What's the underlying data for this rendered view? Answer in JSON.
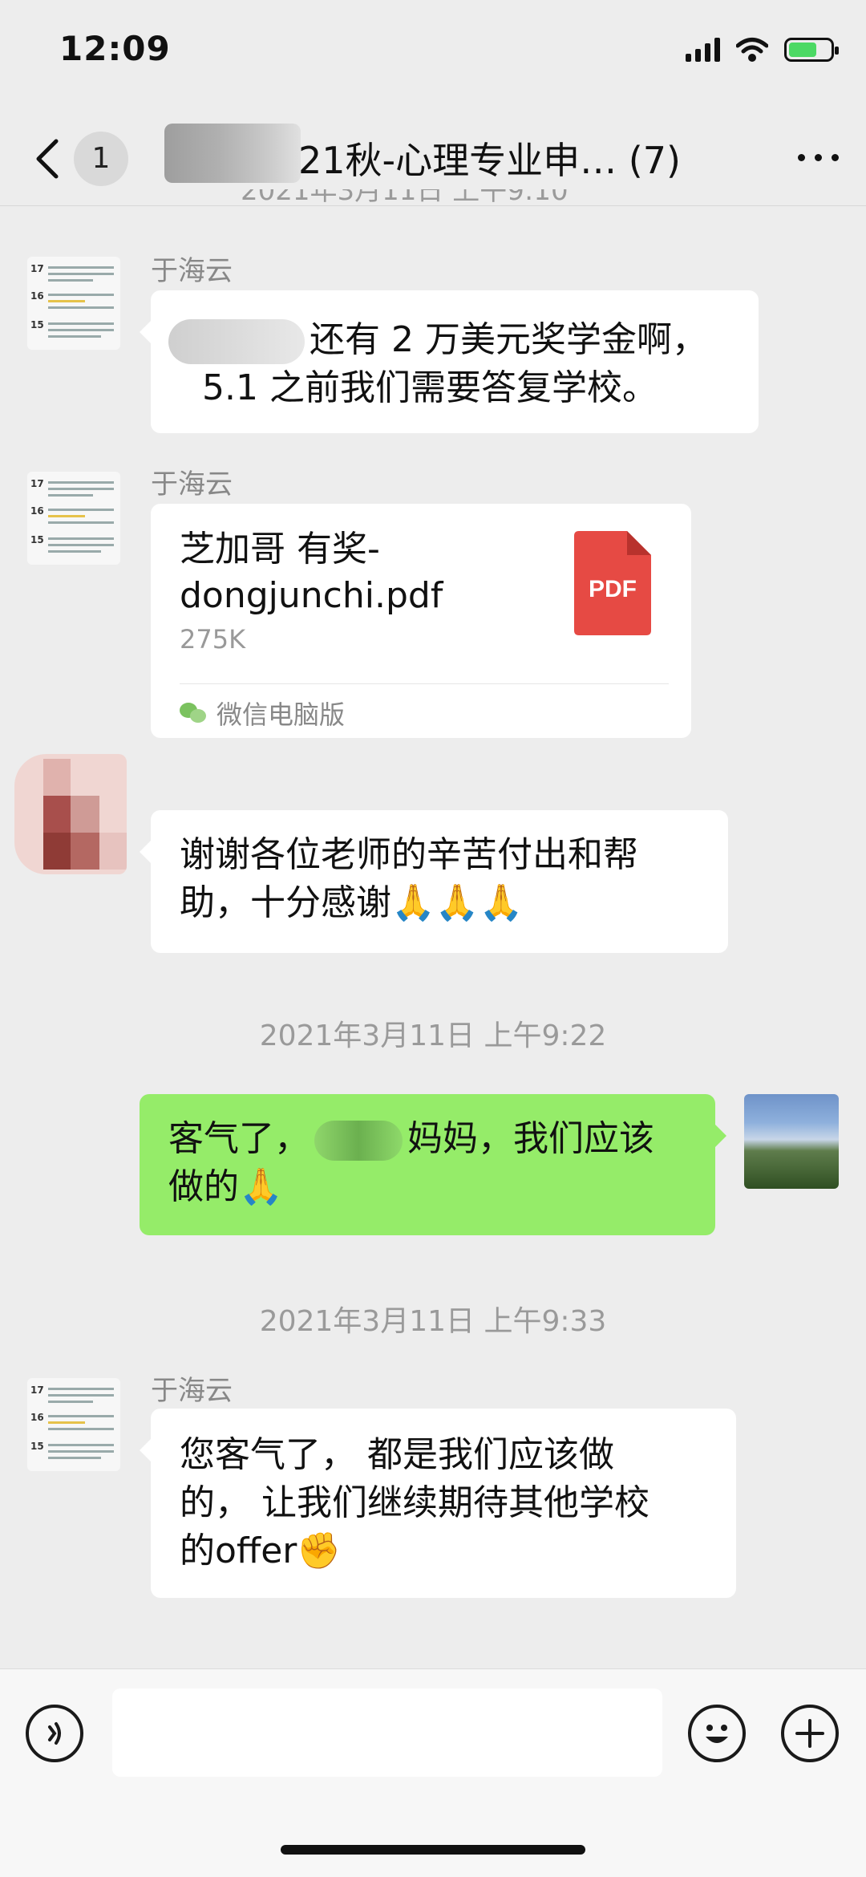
{
  "status_bar": {
    "time": "12:09"
  },
  "nav": {
    "badge": "1",
    "title": "21秋-心理专业申… (7)"
  },
  "cut_timestamp": "2021年3月11日 上午9:10",
  "messages": [
    {
      "sender": "于海云",
      "text_line1": "还有 2 万美元奖学金啊，",
      "text_line2": "5.1 之前我们需要答复学校。"
    },
    {
      "sender": "于海云",
      "file_name": "芝加哥 有奖-dongjunchi.pdf",
      "file_size": "275K",
      "file_source": "微信电脑版",
      "file_type": "PDF"
    },
    {
      "text_line1": "谢谢各位老师的辛苦付出和帮",
      "text_line2": "助，十分感谢🙏🙏🙏"
    },
    {
      "text_pre": "客气了，",
      "text_post": "妈妈，我们应该",
      "text_line2": "做的🙏"
    },
    {
      "sender": "于海云",
      "text_line1": "您客气了， 都是我们应该做",
      "text_line2": "的， 让我们继续期待其他学校",
      "text_line3": "的offer✊"
    }
  ],
  "timestamps": [
    "2021年3月11日 上午9:22",
    "2021年3月11日 上午9:33"
  ],
  "colors": {
    "self_bubble": "#95ec69",
    "background": "#ededed",
    "pdf_red": "#e64a44"
  },
  "icons": [
    "back-arrow-icon",
    "more-icon",
    "pdf-file-icon",
    "wechat-icon",
    "voice-icon",
    "emoji-icon",
    "add-icon"
  ]
}
